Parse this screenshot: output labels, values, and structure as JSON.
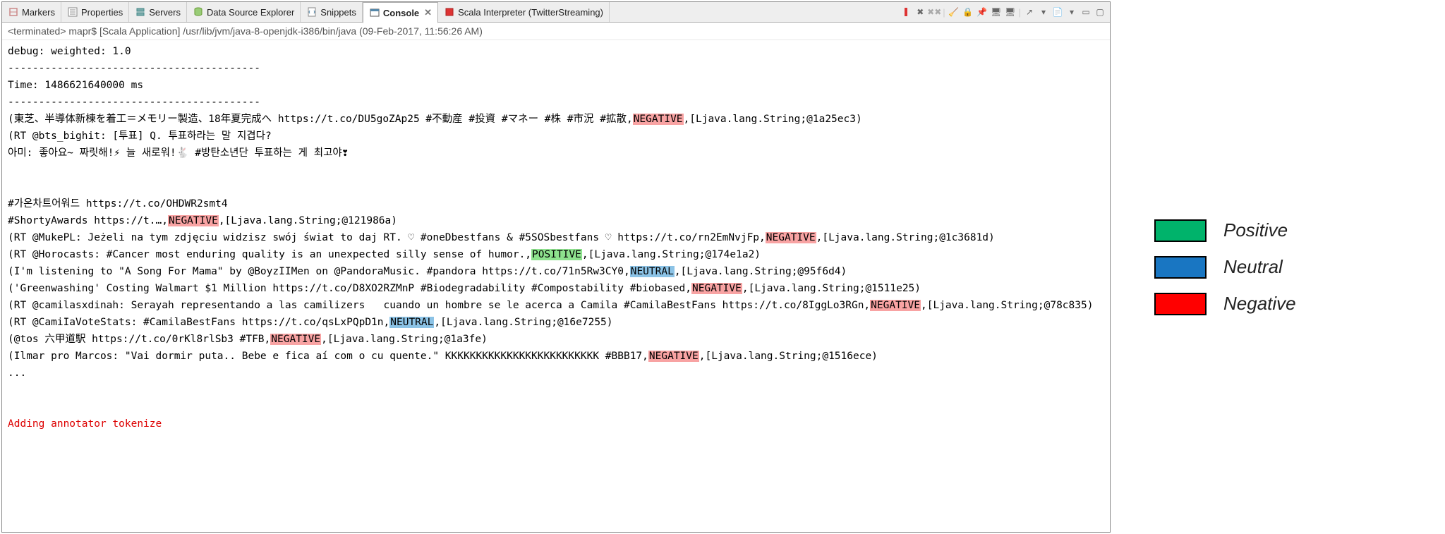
{
  "tabs": [
    {
      "label": "Markers"
    },
    {
      "label": "Properties"
    },
    {
      "label": "Servers"
    },
    {
      "label": "Data Source Explorer"
    },
    {
      "label": "Snippets"
    },
    {
      "label": "Console",
      "active": true
    },
    {
      "label": "Scala Interpreter (TwitterStreaming)"
    }
  ],
  "run_info": "<terminated> mapr$ [Scala Application] /usr/lib/jvm/java-8-openjdk-i386/bin/java (09-Feb-2017, 11:56:26 AM)",
  "console": {
    "debug_line": "debug: weighted: 1.0",
    "dash_line": "-----------------------------------------",
    "time_line": "Time: 1486621640000 ms",
    "lines": [
      {
        "pre": "(東芝、半導体新棟を着工＝メモリー製造、18年夏完成へ https://t.co/DU5goZAp25 #不動産 #投資 #マネー #株 #市況 #拡散,",
        "tag": "NEGATIVE",
        "cls": "neg",
        "post": ",[Ljava.lang.String;@1a25ec3)"
      },
      {
        "plain": "(RT @bts_bighit: [투표] Q. 투표하라는 말 지겹다?"
      },
      {
        "plain": "아미: 좋아요~ 짜릿해!⚡ 늘 새로워!🐇 #방탄소년단 투표하는 게 최고야❣"
      },
      {
        "plain": ""
      },
      {
        "plain": ""
      },
      {
        "plain": "#가온차트어워드 https://t.co/OHDWR2smt4"
      },
      {
        "pre": "#ShortyAwards https://t.…,",
        "tag": "NEGATIVE",
        "cls": "neg",
        "post": ",[Ljava.lang.String;@121986a)"
      },
      {
        "pre": "(RT @MukePL: Jeżeli na tym zdjęciu widzisz swój świat to daj RT. ♡ #oneDbestfans & #5SOSbestfans ♡ https://t.co/rn2EmNvjFp,",
        "tag": "NEGATIVE",
        "cls": "neg",
        "post": ",[Ljava.lang.String;@1c3681d)"
      },
      {
        "pre": "(RT @Horocasts: #Cancer most enduring quality is an unexpected silly sense of humor.,",
        "tag": "POSITIVE",
        "cls": "pos",
        "post": ",[Ljava.lang.String;@174e1a2)"
      },
      {
        "pre": "(I'm listening to \"A Song For Mama\" by @BoyzIIMen on @PandoraMusic. #pandora https://t.co/71n5Rw3CY0,",
        "tag": "NEUTRAL",
        "cls": "neu",
        "post": ",[Ljava.lang.String;@95f6d4)"
      },
      {
        "pre": "('Greenwashing' Costing Walmart $1 Million https://t.co/D8XO2RZMnP #Biodegradability #Compostability #biobased,",
        "tag": "NEGATIVE",
        "cls": "neg",
        "post": ",[Ljava.lang.String;@1511e25)"
      },
      {
        "pre": "(RT @camilasxdinah: Serayah representando a las camilizers   cuando un hombre se le acerca a Camila #CamilaBestFans https://t.co/8IggLo3RGn,",
        "tag": "NEGATIVE",
        "cls": "neg",
        "post": ",[Ljava.lang.String;@78c835)"
      },
      {
        "pre": "(RT @CamiIaVoteStats: #CamilaBestFans https://t.co/qsLxPQpD1n,",
        "tag": "NEUTRAL",
        "cls": "neu",
        "post": ",[Ljava.lang.String;@16e7255)"
      },
      {
        "pre": "(@tos 六甲道駅 https://t.co/0rKl8rlSb3 #TFB,",
        "tag": "NEGATIVE",
        "cls": "neg",
        "post": ",[Ljava.lang.String;@1a3fe)"
      },
      {
        "pre": "(Ilmar pro Marcos: \"Vai dormir puta.. Bebe e fica aí com o cu quente.\" KKKKKKKKKKKKKKKKKKKKKKKKK #BBB17,",
        "tag": "NEGATIVE",
        "cls": "neg",
        "post": ",[Ljava.lang.String;@1516ece)"
      },
      {
        "plain": "..."
      }
    ],
    "footer": "Adding annotator tokenize"
  },
  "legend": {
    "positive": "Positive",
    "neutral": "Neutral",
    "negative": "Negative"
  }
}
